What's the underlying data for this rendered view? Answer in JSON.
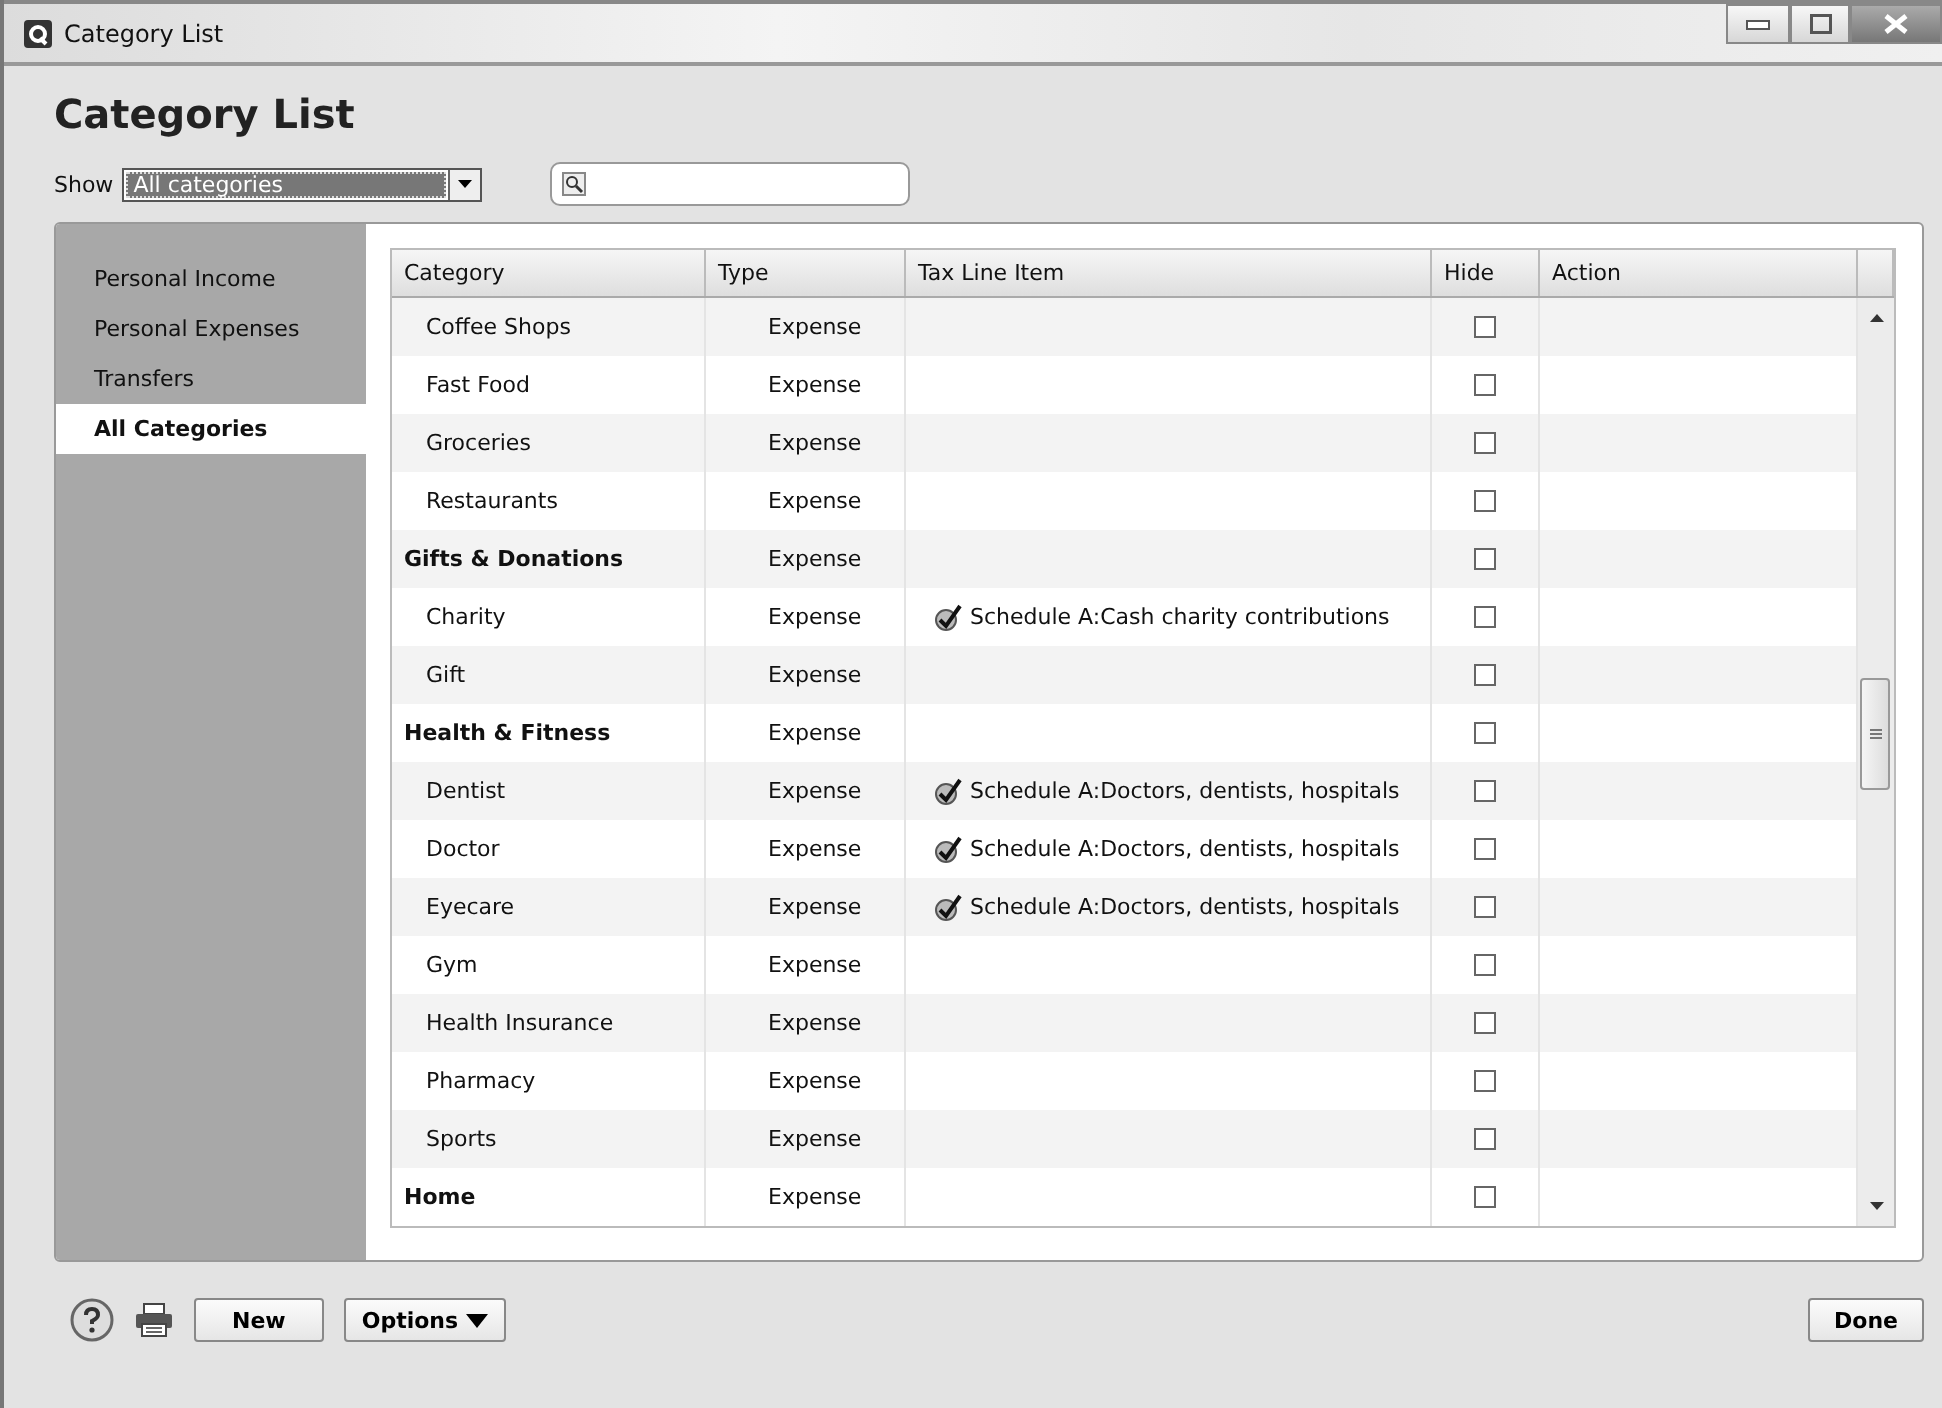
{
  "window": {
    "title": "Category List"
  },
  "heading": "Category List",
  "show": {
    "label": "Show",
    "value": "All categories"
  },
  "sidebar": {
    "items": [
      {
        "label": "Personal Income",
        "selected": false
      },
      {
        "label": "Personal Expenses",
        "selected": false
      },
      {
        "label": "Transfers",
        "selected": false
      },
      {
        "label": "All Categories",
        "selected": true
      }
    ]
  },
  "table": {
    "columns": [
      "Category",
      "Type",
      "Tax Line Item",
      "Hide",
      "Action"
    ],
    "rows": [
      {
        "kind": "item",
        "category": "Coffee Shops",
        "type": "Expense",
        "hidden": false
      },
      {
        "kind": "item",
        "category": "Fast Food",
        "type": "Expense",
        "hidden": false
      },
      {
        "kind": "item",
        "category": "Groceries",
        "type": "Expense",
        "hidden": false
      },
      {
        "kind": "item",
        "category": "Restaurants",
        "type": "Expense",
        "hidden": false
      },
      {
        "kind": "group",
        "category": "Gifts & Donations",
        "type": "Expense",
        "hidden": false
      },
      {
        "kind": "item",
        "category": "Charity",
        "type": "Expense",
        "tax_line": "Schedule A:Cash charity contributions",
        "hidden": false
      },
      {
        "kind": "item",
        "category": "Gift",
        "type": "Expense",
        "hidden": false
      },
      {
        "kind": "group",
        "category": "Health & Fitness",
        "type": "Expense",
        "hidden": false
      },
      {
        "kind": "item",
        "category": "Dentist",
        "type": "Expense",
        "tax_line": "Schedule A:Doctors, dentists, hospitals",
        "hidden": false
      },
      {
        "kind": "item",
        "category": "Doctor",
        "type": "Expense",
        "tax_line": "Schedule A:Doctors, dentists, hospitals",
        "hidden": false
      },
      {
        "kind": "item",
        "category": "Eyecare",
        "type": "Expense",
        "tax_line": "Schedule A:Doctors, dentists, hospitals",
        "hidden": false
      },
      {
        "kind": "item",
        "category": "Gym",
        "type": "Expense",
        "hidden": false
      },
      {
        "kind": "item",
        "category": "Health Insurance",
        "type": "Expense",
        "hidden": false
      },
      {
        "kind": "item",
        "category": "Pharmacy",
        "type": "Expense",
        "hidden": false
      },
      {
        "kind": "item",
        "category": "Sports",
        "type": "Expense",
        "hidden": false
      },
      {
        "kind": "group",
        "category": "Home",
        "type": "Expense",
        "hidden": false
      }
    ]
  },
  "footer": {
    "new": "New",
    "options": "Options",
    "done": "Done"
  }
}
